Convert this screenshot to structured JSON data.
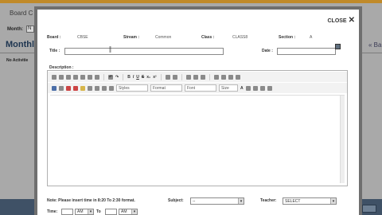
{
  "background": {
    "breadcrumb": "Board C",
    "month_label": "Month:",
    "month_value": "N",
    "page_title": "Monthl",
    "no_activities": "No Activitie",
    "right_link": "« Ba"
  },
  "modal": {
    "close_label": "CLOSE",
    "info": {
      "board_label": "Board :",
      "board_value": "CBSE",
      "stream_label": "Stream :",
      "stream_value": "Common",
      "class_label": "Class :",
      "class_value": "CLASS8",
      "section_label": "Section :",
      "section_value": "A"
    },
    "title_label": "Title :",
    "date_label": "Date :",
    "description_label": "Description :",
    "toolbar": {
      "styles": "Styles",
      "format": "Format",
      "font": "Font",
      "size": "Size"
    },
    "note": "Note: Please insert time in 8:20 To 2:30 format.",
    "subject_label": "Subject:",
    "subject_value": "--",
    "teacher_label": "Teacher:",
    "teacher_value": "SELECT",
    "time_label": "Time:",
    "time_to": "To",
    "am1": "AM",
    "am2": "AM"
  }
}
